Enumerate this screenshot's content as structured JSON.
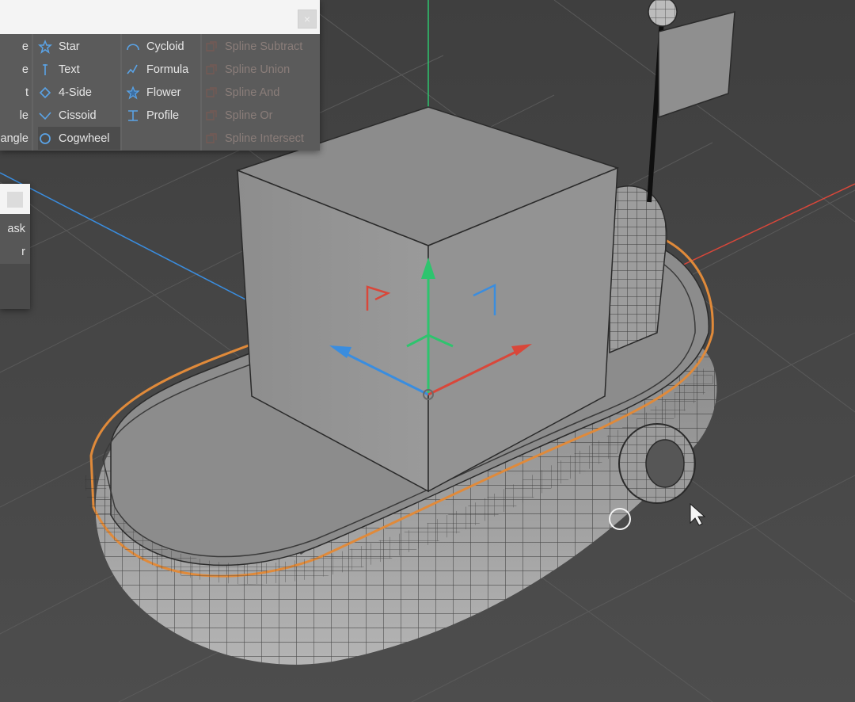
{
  "spline_palette": {
    "columns": [
      {
        "items": [
          {
            "label": "e",
            "icon": "none"
          },
          {
            "label": "e",
            "icon": "none"
          },
          {
            "label": "t",
            "icon": "none"
          },
          {
            "label": "le",
            "icon": "none"
          },
          {
            "label": "angle",
            "icon": "none"
          }
        ]
      },
      {
        "items": [
          {
            "label": "Star",
            "icon": "star-icon"
          },
          {
            "label": "Text",
            "icon": "text-icon"
          },
          {
            "label": "4-Side",
            "icon": "diamond-icon"
          },
          {
            "label": "Cissoid",
            "icon": "cissoid-icon"
          },
          {
            "label": "Cogwheel",
            "icon": "cogwheel-icon",
            "selected": true
          }
        ]
      },
      {
        "items": [
          {
            "label": "Cycloid",
            "icon": "cycloid-icon"
          },
          {
            "label": "Formula",
            "icon": "formula-icon"
          },
          {
            "label": "Flower",
            "icon": "flower-icon"
          },
          {
            "label": "Profile",
            "icon": "profile-icon"
          }
        ]
      },
      {
        "items": [
          {
            "label": "Spline Subtract",
            "icon": "spline-subtract-icon",
            "disabled": true
          },
          {
            "label": "Spline Union",
            "icon": "spline-union-icon",
            "disabled": true
          },
          {
            "label": "Spline And",
            "icon": "spline-and-icon",
            "disabled": true
          },
          {
            "label": "Spline Or",
            "icon": "spline-or-icon",
            "disabled": true
          },
          {
            "label": "Spline Intersect",
            "icon": "spline-intersect-icon",
            "disabled": true
          }
        ]
      }
    ],
    "close_icon": "close-icon"
  },
  "second_palette": {
    "items": [
      {
        "label": "ask"
      },
      {
        "label": "r"
      }
    ]
  },
  "colors": {
    "viewport_bg": "#474747",
    "axis_x": "#d9473a",
    "axis_y": "#2ec46e",
    "axis_z": "#3a8ddf",
    "selection_outline": "#e08a3a",
    "icon_blue": "#5aa3e6"
  }
}
